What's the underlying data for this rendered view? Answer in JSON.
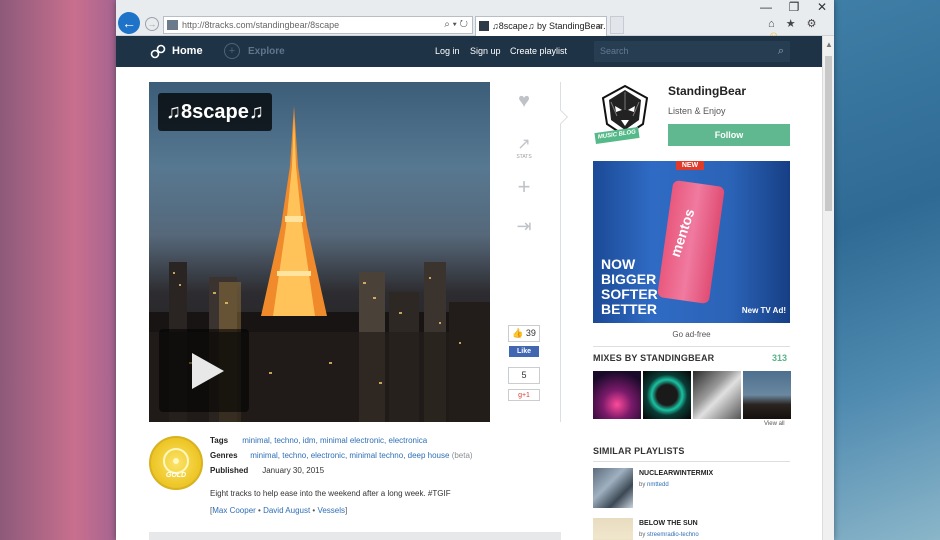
{
  "browser": {
    "address": "http://8tracks.com/standingbear/8scape",
    "tab_title": "♫8scape♫ by StandingBear...",
    "tab_close": "×",
    "back": "←",
    "forward": "→",
    "addr_tools": "⌕ ▾ ↻",
    "window_controls": [
      "—",
      "❐",
      "✕"
    ],
    "toolbar_icons": [
      "⌂",
      "★",
      "⚙"
    ],
    "smiley": "☺"
  },
  "nav": {
    "logo_icon": "link-icon",
    "home": "Home",
    "explore": "Explore",
    "explore_icon": "compass-icon",
    "login": "Log in",
    "signup": "Sign up",
    "create": "Create playlist",
    "search_placeholder": "Search",
    "search_icon": "⌕"
  },
  "mix": {
    "title": "♫8scape♫",
    "actions": {
      "like_icon": "♥",
      "stats_icon": "↗",
      "stats_caption": "STATS",
      "add_icon": "+",
      "share_icon": "⇥"
    },
    "social": {
      "like_count": "39",
      "fb_like": "Like",
      "share_count": "5",
      "gplus": "g+1"
    },
    "badge": "GOLD",
    "tags_label": "Tags",
    "tags": "minimal, techno, idm, minimal electronic, electronica",
    "genres_label": "Genres",
    "genres": "minimal, techno, electronic, minimal techno, deep house",
    "genres_beta": "(beta)",
    "published_label": "Published",
    "published": "January 30, 2015",
    "description": "Eight tracks to help ease into the weekend after a long week. #TGIF",
    "artists_open": "[",
    "artists": [
      "Max Cooper",
      "David August",
      "Vessels"
    ],
    "artists_sep": " • ",
    "artists_close": "]"
  },
  "profile": {
    "name": "StandingBear",
    "tagline": "Listen & Enjoy",
    "follow": "Follow",
    "image_tag": "MUSIC BLOG"
  },
  "ad": {
    "new_label": "NEW",
    "brand": "mentos",
    "slogan": [
      "NOW",
      "BIGGER",
      "SOFTER",
      "BETTER"
    ],
    "tv": "New TV Ad!",
    "ad_free": "Go ad-free"
  },
  "mixes": {
    "title": "MIXES BY STANDINGBEAR",
    "count": "313",
    "view_all": "View all"
  },
  "similar": {
    "title": "SIMILAR PLAYLISTS",
    "items": [
      {
        "title": "NUCLEARWINTERMIX",
        "by": "by",
        "user": "nmttedd"
      },
      {
        "title": "BELOW THE SUN",
        "by": "by",
        "user": "streemradio-techno"
      }
    ]
  },
  "colors": {
    "nav_bg": "#1f3347",
    "follow_green": "#5fb88f",
    "link_blue": "#2f6fb6",
    "count_green": "#59b48a"
  }
}
